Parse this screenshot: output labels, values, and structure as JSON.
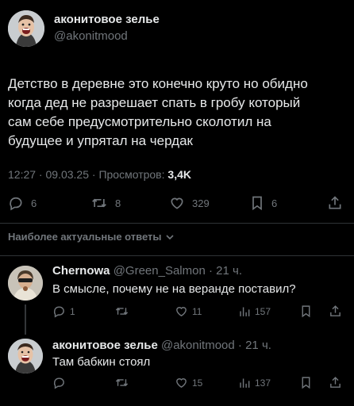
{
  "main_post": {
    "author_name": "аконитовое зелье",
    "author_handle": "@akonitmood",
    "text_lines": [
      "Детство в деревне это конечно круто но обидно",
      "когда дед не разрешает спать в гробу который",
      "сам себе предусмотрительно сколотил на",
      "будущее и упрятал на чердак"
    ],
    "time": "12:27",
    "date": "09.03.25",
    "views_label": "Просмотров:",
    "views_count": "3,4K",
    "stats": {
      "replies": "6",
      "reposts": "8",
      "likes": "329",
      "bookmarks": "6"
    }
  },
  "replies_sort_label": "Наиболее актуальные ответы",
  "replies": [
    {
      "author_name": "Chernowa",
      "author_handle": "@Green_Salmon",
      "age": "21 ч.",
      "text": "В смысле, почему не на веранде поставил?",
      "stats": {
        "replies": "1",
        "reposts": "",
        "likes": "11",
        "views": "157"
      }
    },
    {
      "author_name": "аконитовое зелье",
      "author_handle": "@akonitmood",
      "age": "21 ч.",
      "text": "Там бабкин стоял",
      "stats": {
        "replies": "",
        "reposts": "",
        "likes": "15",
        "views": "137"
      }
    }
  ],
  "icons": [
    "reply-icon",
    "repost-icon",
    "like-icon",
    "bookmark-icon",
    "share-icon",
    "views-icon",
    "chevron-down-icon"
  ],
  "colors": {
    "background": "#000000",
    "text": "#e7e9ea",
    "muted": "#71767b",
    "divider": "#2f3336"
  }
}
